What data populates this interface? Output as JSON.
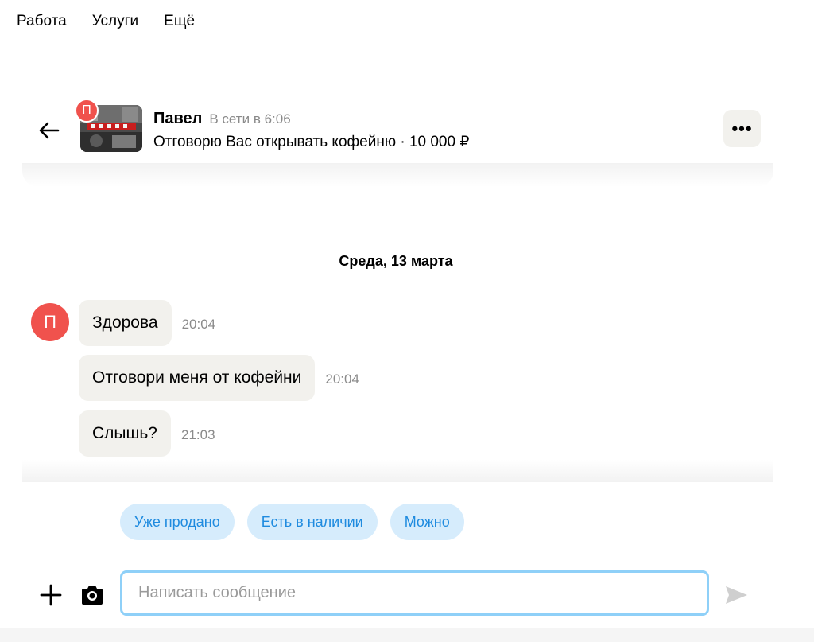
{
  "nav": {
    "items": [
      "Работа",
      "Услуги",
      "Ещё"
    ]
  },
  "chat_header": {
    "avatar_letter": "П",
    "seller_name": "Павел",
    "status": "В сети в 6:06",
    "listing": "Отговорю Вас открывать кофейню · 10 000 ₽",
    "more_label": "•••"
  },
  "date_separator": "Среда, 13 марта",
  "messages": [
    {
      "text": "Здорова",
      "time": "20:04"
    },
    {
      "text": "Отговори меня от кофейни",
      "time": "20:04"
    },
    {
      "text": "Слышь?",
      "time": "21:03"
    }
  ],
  "message_avatar_letter": "П",
  "quick_replies": [
    "Уже продано",
    "Есть в наличии",
    "Можно"
  ],
  "composer": {
    "placeholder": "Написать сообщение"
  },
  "colors": {
    "avatar": "#f0524d",
    "chip_bg": "#d6ecfc",
    "chip_text": "#1f8bdf",
    "bubble": "#f2f1ed",
    "input_border": "#8fd0f8"
  }
}
